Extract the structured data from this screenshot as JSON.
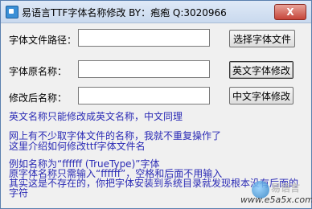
{
  "window": {
    "title": "易语言TTF字体名称修改    BY：疱疱 Q:3020966",
    "close_label": "X"
  },
  "form": {
    "path_label": "字体文件路径：",
    "path_value": "",
    "original_label": "字体原名称：",
    "original_value": "",
    "new_label": "修改后名称：",
    "new_value": ""
  },
  "buttons": {
    "select_font": "选择字体文件",
    "english_edit": "英文字体修改",
    "chinese_edit": "中文字体修改"
  },
  "info": {
    "line1": "英文名称只能修改成英文名称，中文同理",
    "line2": "网上有不少取字体文件的名称，我就不重复操作了",
    "line3": "这里介绍如何修改ttf字体文件名",
    "line4": "例如名称为“ffffff (TrueType)”字体",
    "line5": "原字体名称只需输入“ffffff”，空格和后面不用输入",
    "line6": "其实这是不存在的，你把字体安装到系统目录就发现根本没有后面的",
    "line7": "字符"
  },
  "watermark": {
    "name": "易语言",
    "url": "www.e5a5x.com"
  }
}
